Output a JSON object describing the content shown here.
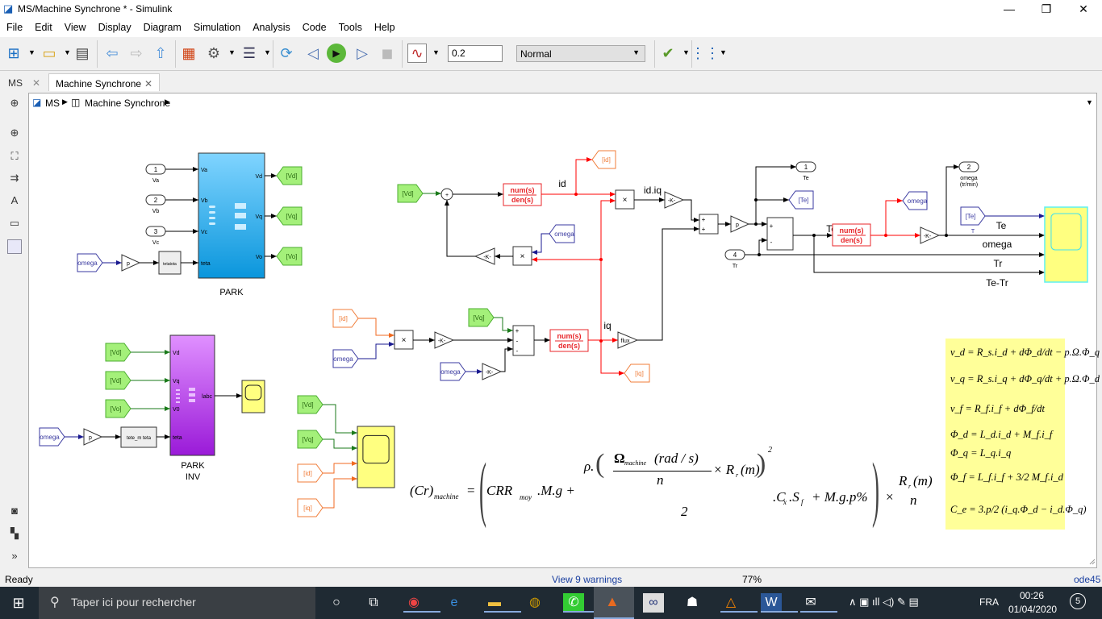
{
  "window": {
    "title": "MS/Machine Synchrone * - Simulink",
    "minimize": "—",
    "maximize": "❐",
    "close": "✕"
  },
  "menu": [
    "File",
    "Edit",
    "View",
    "Display",
    "Diagram",
    "Simulation",
    "Analysis",
    "Code",
    "Tools",
    "Help"
  ],
  "toolbar": {
    "stop_time": "0.2",
    "sim_mode": "Normal",
    "icons": [
      "new-model-icon",
      "open-icon",
      "save-icon",
      "back-icon",
      "forward-icon",
      "up-icon",
      "library-browser-icon",
      "settings-gear-icon",
      "model-explorer-icon",
      "update-diagram-icon",
      "step-back-icon",
      "run-icon",
      "step-forward-icon",
      "stop-icon",
      "data-inspector-icon",
      "check-icon",
      "build-icon"
    ]
  },
  "tabs": [
    {
      "label": "MS",
      "close": "✕"
    },
    {
      "label": "Machine Synchrone",
      "close": "✕"
    }
  ],
  "breadcrumb": [
    "MS",
    "Machine Synchrone"
  ],
  "status": {
    "left": "Ready",
    "warnings": "View 9 warnings",
    "zoom": "77%",
    "solver": "ode45"
  },
  "taskbar": {
    "search_placeholder": "Taper ici pour rechercher",
    "lang": "FRA",
    "time": "00:26",
    "date": "01/04/2020",
    "notifications": "5"
  },
  "diagram": {
    "park": {
      "name": "PARK",
      "inputs": [
        "Va",
        "Vb",
        "Vc",
        "teta"
      ],
      "outputs": [
        "Vd",
        "Vq",
        "Vo"
      ]
    },
    "park_inv": {
      "name": [
        "PARK",
        "INV"
      ],
      "inputs": [
        "Vd",
        "Vq",
        "V0",
        "teta"
      ],
      "output": "labc"
    },
    "theta_blocks": [
      "tetatota",
      "tete_m  teta"
    ],
    "inports": [
      {
        "num": "1",
        "label": "Va"
      },
      {
        "num": "2",
        "label": "Vb"
      },
      {
        "num": "3",
        "label": "Vc"
      },
      {
        "num": "4",
        "label": "Tr"
      }
    ],
    "outports": [
      {
        "num": "1",
        "label": "Te"
      },
      {
        "num": "2",
        "label": "omega",
        "sub": "(tr/min)"
      }
    ],
    "tags": {
      "vd": "[Vd]",
      "vq": "[Vq]",
      "vo": "[Vo]",
      "id": "[id]",
      "iq": "[iq]",
      "te": "[Te]",
      "omega": "omega",
      "te_sub": "T"
    },
    "gains": {
      "k": "-K-",
      "p": "p",
      "flux": "flux"
    },
    "tf": {
      "num": "num(s)",
      "den": "den(s)"
    },
    "product": "×",
    "signs": {
      "plus": "+",
      "minus": "-"
    },
    "signals": {
      "id": "id",
      "idiq": "id.iq",
      "iq": "iq",
      "tetr": "Te-Tr",
      "te": "Te",
      "omega": "omega",
      "tr": "Tr",
      "tetr2": "Te-Tr"
    },
    "colors": {
      "from_green": "#a4f07a",
      "tag_orange": "#f07d3a",
      "tag_blue": "#3a3aa0",
      "tf_red": "#e8262a",
      "scope_yellow": "#ffff80",
      "park": "#29a8ec",
      "park_inv": "#b54bf0",
      "eq_panel": "#ffff99"
    }
  },
  "formula": {
    "lhs": "(Cr)",
    "lhs_sub": "machine",
    "eq": "=",
    "t1": "CRR",
    "t1_sub": "moy",
    "t2": ".M.g +",
    "rho": "ρ.",
    "omega": "Ω",
    "omega_sub": "machine",
    "unit": "(rad / s)",
    "n": "n",
    "times_r": "× R",
    "r_sub": "r",
    "m": "(m)",
    "sq": "2",
    "two": "2",
    "t3": ".C",
    "cx_sub": "x",
    "t4": ".S",
    "sf_sub": "f",
    "t5": "+ M.g.p%",
    "times": "×",
    "r2": "R",
    "r2_sub": "r",
    "m2": "(m)",
    "n2": "n"
  },
  "equations": [
    "v_d = R_s.i_d + dΦ_d/dt − p.Ω.Φ_q",
    "v_q = R_s.i_q + dΦ_q/dt + p.Ω.Φ_d",
    "v_f = R_f.i_f + dΦ_f/dt",
    "Φ_d = L_d.i_d + M_f.i_f",
    "Φ_q = L_q.i_q",
    "Φ_f = L_f.i_f + 3/2 M_f.i_d",
    "C_e = 3.p/2 (i_q.Φ_d − i_d.Φ_q)"
  ]
}
